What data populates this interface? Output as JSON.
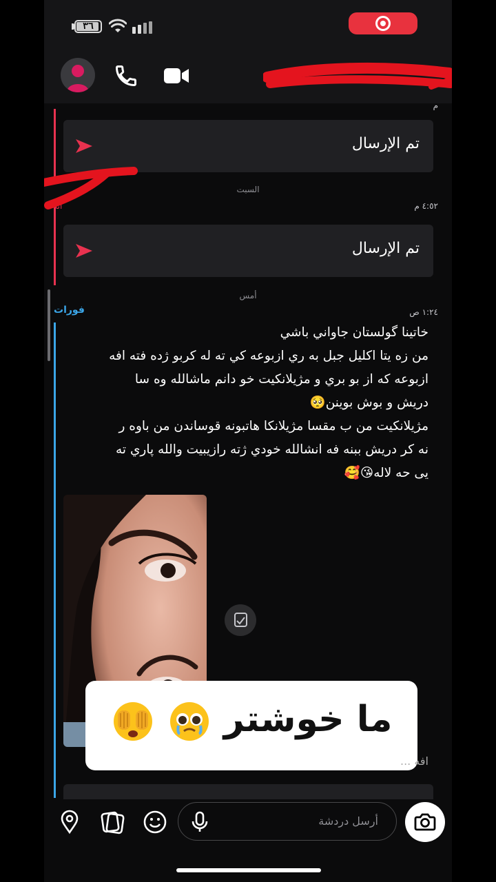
{
  "status_bar": {
    "battery": "٣٦",
    "icons": [
      "battery-icon",
      "wifi-icon",
      "signal-icon",
      "screen-record-icon"
    ]
  },
  "header": {
    "contact_name": "",
    "icons": [
      "avatar",
      "phone-icon",
      "video-icon",
      "back-chevron-icon"
    ],
    "accent": "#e8324f"
  },
  "thread": {
    "top_partial_time": "م",
    "messages": [
      {
        "type": "sent-status",
        "text": "تم الإرسال"
      },
      {
        "type": "day",
        "text": "السبت"
      },
      {
        "type": "time",
        "text": "٤:٥٢ م",
        "sender": "أنا"
      },
      {
        "type": "sent-status",
        "text": "تم الإرسال"
      },
      {
        "type": "day",
        "text": "أمس"
      }
    ],
    "friend_message": {
      "sender": "فورات",
      "time": "١:٢٤ ص",
      "lines": [
        "خاتينا گولستان جاواني باشي",
        "من زه يتا اكليل جبل به ري ازبوعه كي ته له كربو ژده فته افه",
        "ازبوعه كه از بو بري و مژيلانكيت خو دانم ماشالله وه سا",
        "دريش و بوش بوينن🥺",
        "مژيلانكيت من ب مقسا مژيلانكا هاتبونه قوساندن من باوه ر",
        "نه كر دريش ببنه فه انشالله خودي ژته رازيبيت والله پاري ته",
        "يى حه لاله😘🥰"
      ]
    },
    "partial_text": "افه ...",
    "caption": "ما خوشتر",
    "colors": {
      "friend": "#3ba6e8",
      "me": "#e8324f"
    }
  },
  "composer": {
    "placeholder": "أرسل دردشة",
    "icons": [
      "location-pin-icon",
      "sticker-icon",
      "emoji-icon",
      "microphone-icon",
      "camera-icon"
    ]
  }
}
